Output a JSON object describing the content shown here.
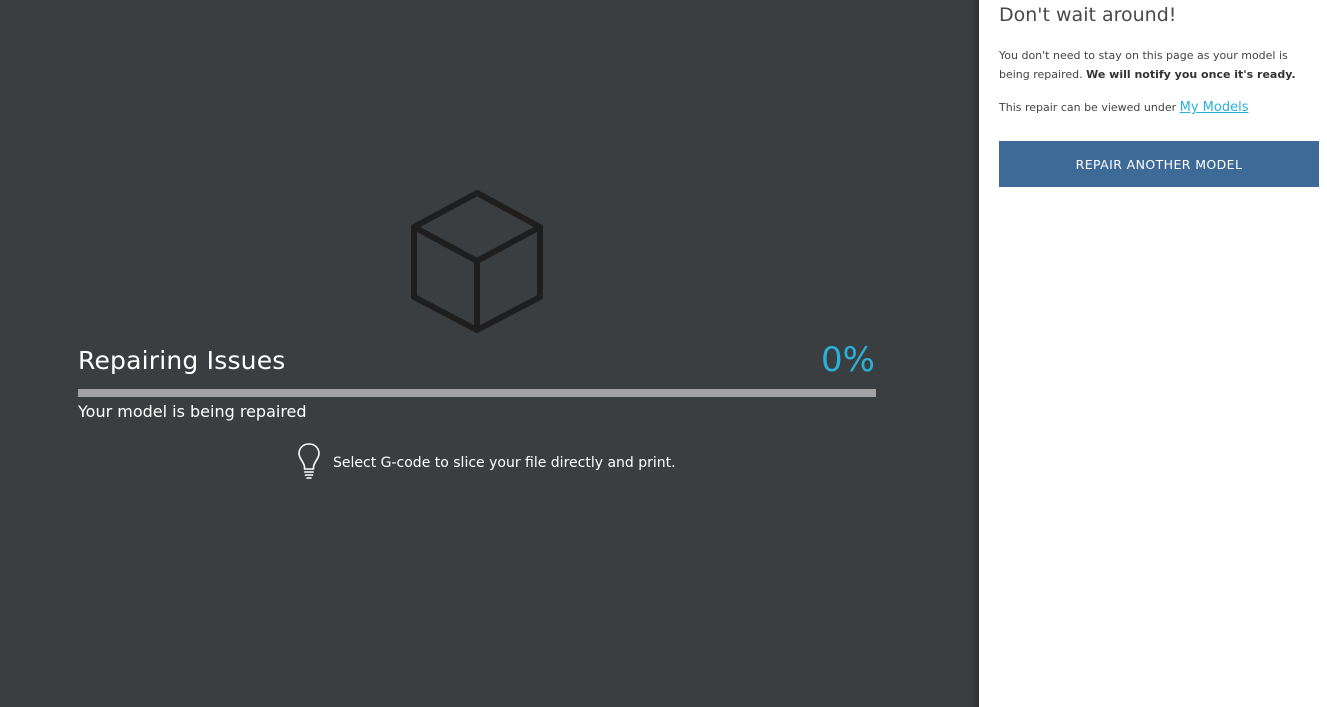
{
  "progress": {
    "title": "Repairing Issues",
    "percent_label": "0%",
    "percent": 0,
    "subtitle": "Your model is being repaired",
    "tip": "Select G-code to slice your file directly and print.",
    "colors": {
      "accent": "#2bb0d8",
      "track": "#a3a3a3",
      "background": "#3b3e41"
    }
  },
  "icons": {
    "cube": "cube-icon",
    "tip": "lightbulb-icon"
  },
  "sidebar": {
    "heading": "Don't wait around!",
    "paragraph_text": "You don't need to stay on this page as your model is being repaired.",
    "paragraph_bold": "We will notify you once it's ready.",
    "view_prefix": "This repair can be viewed under",
    "link_label": "My Models",
    "button_label": "REPAIR ANOTHER MODEL",
    "colors": {
      "button": "#3d6a97",
      "link": "#2bb0d8"
    }
  }
}
